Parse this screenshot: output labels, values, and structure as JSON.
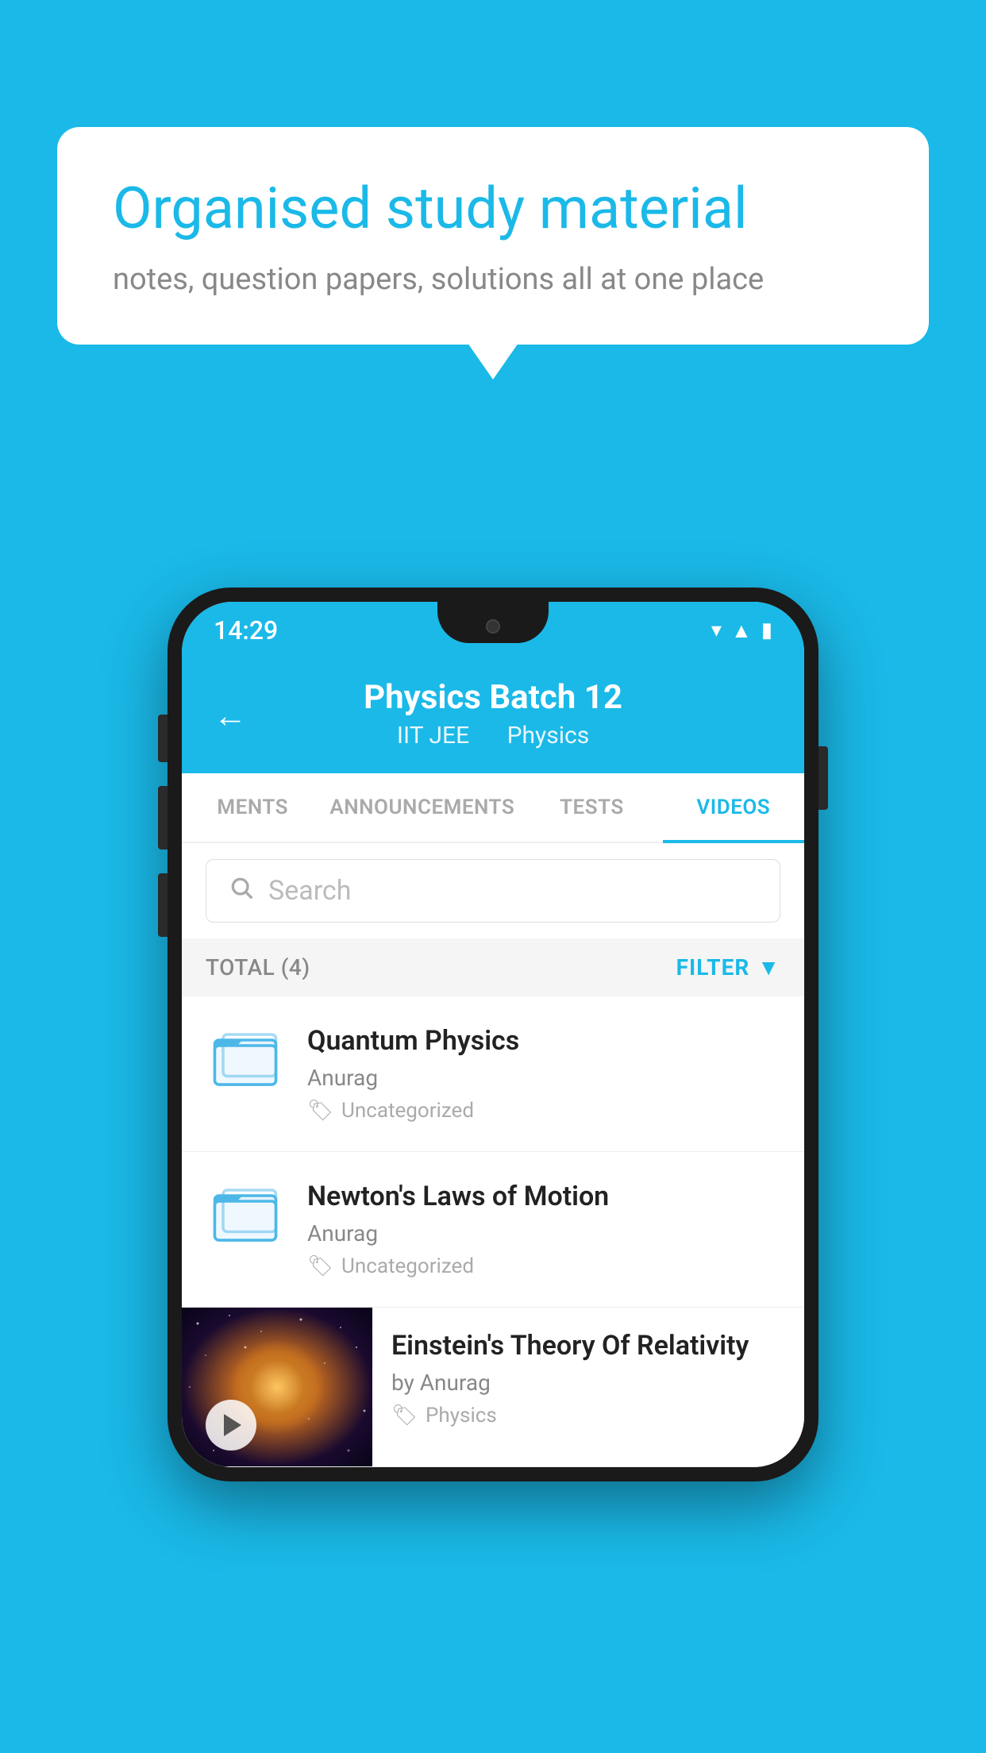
{
  "background": {
    "color": "#1ab9e8"
  },
  "speech_bubble": {
    "title": "Organised study material",
    "subtitle": "notes, question papers, solutions all at one place"
  },
  "phone": {
    "status_bar": {
      "time": "14:29"
    },
    "header": {
      "title": "Physics Batch 12",
      "subtitle_part1": "IIT JEE",
      "subtitle_part2": "Physics",
      "back_label": "←"
    },
    "tabs": [
      {
        "label": "MENTS",
        "active": false
      },
      {
        "label": "ANNOUNCEMENTS",
        "active": false
      },
      {
        "label": "TESTS",
        "active": false
      },
      {
        "label": "VIDEOS",
        "active": true
      }
    ],
    "search": {
      "placeholder": "Search"
    },
    "filter_bar": {
      "total_label": "TOTAL (4)",
      "filter_label": "FILTER"
    },
    "video_items": [
      {
        "title": "Quantum Physics",
        "author": "Anurag",
        "tag": "Uncategorized",
        "has_thumbnail": false
      },
      {
        "title": "Newton's Laws of Motion",
        "author": "Anurag",
        "tag": "Uncategorized",
        "has_thumbnail": false
      },
      {
        "title": "Einstein's Theory Of Relativity",
        "author": "by Anurag",
        "tag": "Physics",
        "has_thumbnail": true
      }
    ]
  }
}
